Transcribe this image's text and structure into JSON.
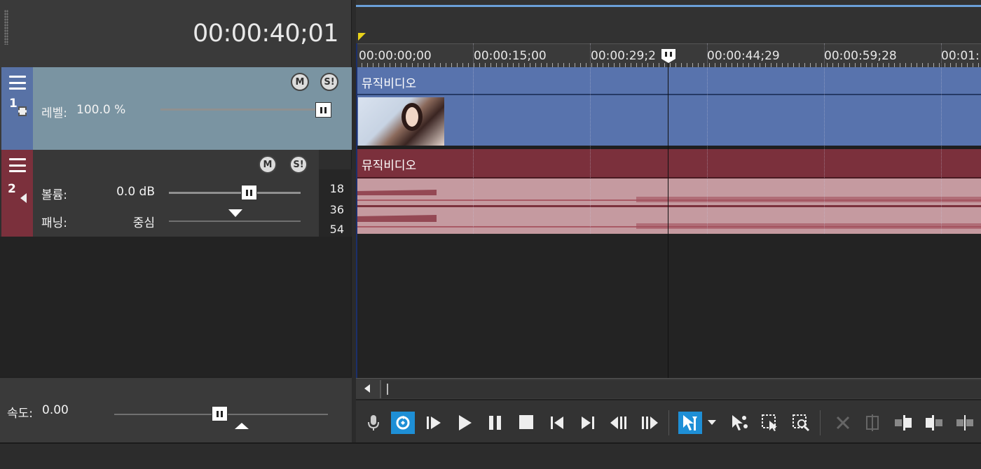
{
  "header": {
    "timecode": "00:00:40;01"
  },
  "ruler": {
    "labels": [
      "00:00:00;00",
      "00:00:15;00",
      "00:00:29;2",
      "00:00:44;29",
      "00:00:59;28",
      "00:01:"
    ]
  },
  "video_track": {
    "number": "1",
    "level_label": "레벨:",
    "level_value": "100.0 %",
    "level_fraction": 1.0,
    "clip_title": "뮤직비디오",
    "color": "#5873ad"
  },
  "audio_track": {
    "number": "2",
    "volume_label": "볼륨:",
    "volume_value": "0.0 dB",
    "pan_label": "패닝:",
    "pan_value": "중심",
    "meter_marks": [
      "18",
      "36",
      "54"
    ],
    "clip_title": "뮤직비디오",
    "color": "#7b303c"
  },
  "speed": {
    "label": "속도:",
    "value": "0.00"
  },
  "buttons": {
    "mute": "M",
    "solo": "S!"
  },
  "icons": {
    "video_track_icon": "film-icon",
    "audio_track_icon": "speaker-icon",
    "transport": [
      "microphone-icon",
      "loop-icon",
      "play-from-start-icon",
      "play-icon",
      "pause-icon",
      "stop-icon",
      "go-to-start-icon",
      "go-to-end-icon",
      "previous-frame-icon",
      "next-frame-icon",
      "normal-edit-tool-icon",
      "dropdown-arrow-icon",
      "envelope-tool-icon",
      "selection-tool-icon",
      "zoom-tool-icon",
      "delete-icon",
      "trim-icon",
      "trim-start-icon",
      "trim-end-icon",
      "split-icon",
      "snap-icon"
    ]
  }
}
